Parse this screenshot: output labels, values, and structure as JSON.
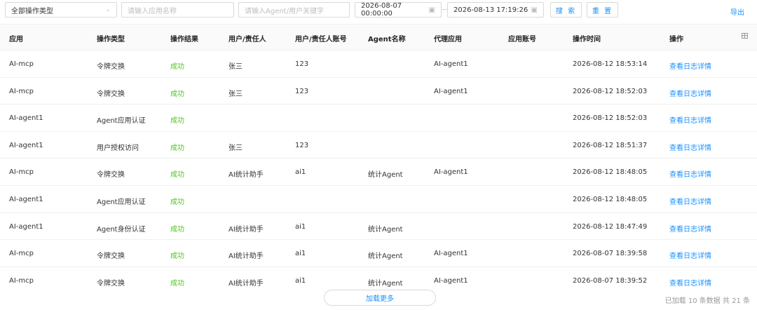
{
  "toolbar": {
    "op_type_select": "全部操作类型",
    "app_name_placeholder": "请输入应用名称",
    "keyword_placeholder": "请输入Agent/用户关键字",
    "date_start": "2026-08-07 00:00:00",
    "date_end": "2026-08-13 17:19:26",
    "range_sep": "—",
    "search_label": "搜 索",
    "reset_label": "重 置",
    "export_label": "导出"
  },
  "columns": [
    "应用",
    "操作类型",
    "操作结果",
    "用户/责任人",
    "用户/责任人账号",
    "Agent名称",
    "代理应用",
    "应用账号",
    "操作时间",
    "操作"
  ],
  "rows": [
    {
      "app": "AI-mcp",
      "op_type": "令牌交换",
      "result": "成功",
      "user": "张三",
      "account": "123",
      "agent": "",
      "proxy_app": "AI-agent1",
      "app_account": "",
      "time": "2026-08-12 18:53:14",
      "action": "查看日志详情"
    },
    {
      "app": "AI-mcp",
      "op_type": "令牌交换",
      "result": "成功",
      "user": "张三",
      "account": "123",
      "agent": "",
      "proxy_app": "AI-agent1",
      "app_account": "",
      "time": "2026-08-12 18:52:03",
      "action": "查看日志详情"
    },
    {
      "app": "AI-agent1",
      "op_type": "Agent应用认证",
      "result": "成功",
      "user": "",
      "account": "",
      "agent": "",
      "proxy_app": "",
      "app_account": "",
      "time": "2026-08-12 18:52:03",
      "action": "查看日志详情"
    },
    {
      "app": "AI-agent1",
      "op_type": "用户授权访问",
      "result": "成功",
      "user": "张三",
      "account": "123",
      "agent": "",
      "proxy_app": "",
      "app_account": "",
      "time": "2026-08-12 18:51:37",
      "action": "查看日志详情"
    },
    {
      "app": "AI-mcp",
      "op_type": "令牌交换",
      "result": "成功",
      "user": "AI统计助手",
      "account": "ai1",
      "agent": "统计Agent",
      "proxy_app": "AI-agent1",
      "app_account": "",
      "time": "2026-08-12 18:48:05",
      "action": "查看日志详情"
    },
    {
      "app": "AI-agent1",
      "op_type": "Agent应用认证",
      "result": "成功",
      "user": "",
      "account": "",
      "agent": "",
      "proxy_app": "",
      "app_account": "",
      "time": "2026-08-12 18:48:05",
      "action": "查看日志详情"
    },
    {
      "app": "AI-agent1",
      "op_type": "Agent身份认证",
      "result": "成功",
      "user": "AI统计助手",
      "account": "ai1",
      "agent": "统计Agent",
      "proxy_app": "",
      "app_account": "",
      "time": "2026-08-12 18:47:49",
      "action": "查看日志详情"
    },
    {
      "app": "AI-mcp",
      "op_type": "令牌交换",
      "result": "成功",
      "user": "AI统计助手",
      "account": "ai1",
      "agent": "统计Agent",
      "proxy_app": "AI-agent1",
      "app_account": "",
      "time": "2026-08-07 18:39:58",
      "action": "查看日志详情"
    },
    {
      "app": "AI-mcp",
      "op_type": "令牌交换",
      "result": "成功",
      "user": "AI统计助手",
      "account": "ai1",
      "agent": "统计Agent",
      "proxy_app": "AI-agent1",
      "app_account": "",
      "time": "2026-08-07 18:39:52",
      "action": "查看日志详情"
    }
  ],
  "footer": {
    "load_more": "加载更多",
    "loaded_info": "已加载 10 条数据 共 21 条"
  },
  "colors": {
    "accent": "#1890ff",
    "success": "#52c41a"
  }
}
